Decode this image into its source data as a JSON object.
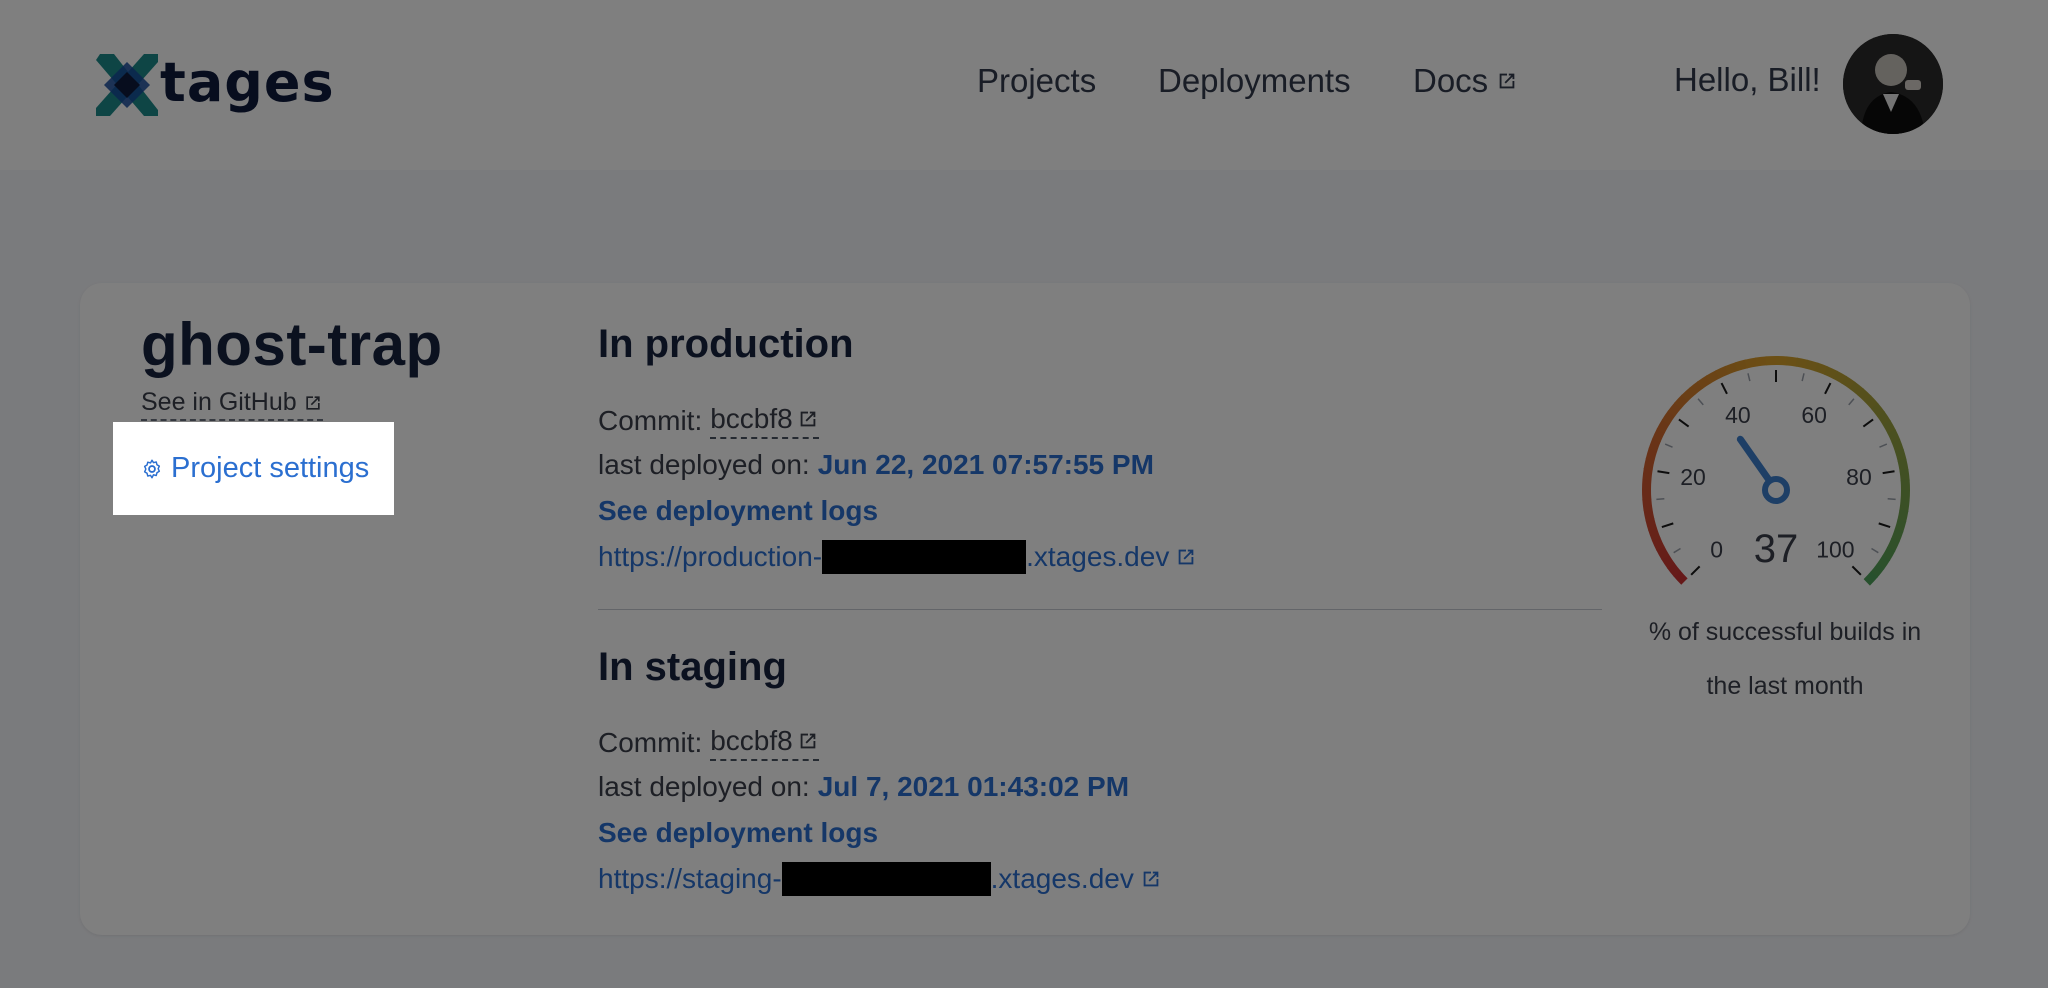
{
  "navbar": {
    "logo_text": "tages",
    "links": [
      "Projects",
      "Deployments",
      "Docs"
    ],
    "greeting": "Hello, Bill!"
  },
  "project": {
    "name": "ghost-trap",
    "github_label": "See in GitHub",
    "settings_label": "Project settings"
  },
  "production": {
    "title": "In production",
    "commit_label": "Commit:",
    "commit": "bccbf8",
    "deployed_label": "last deployed on:",
    "deployed_on": "Jun 22, 2021 07:57:55 PM",
    "logs_label": "See deployment logs",
    "url_prefix": "https://production-",
    "url_suffix": ".xtages.dev"
  },
  "staging": {
    "title": "In staging",
    "commit_label": "Commit:",
    "commit": "bccbf8",
    "deployed_label": "last deployed on:",
    "deployed_on": "Jul 7, 2021 01:43:02 PM",
    "logs_label": "See deployment logs",
    "url_prefix": "https://staging-",
    "url_suffix": ".xtages.dev"
  },
  "gauge": {
    "value": 37,
    "min": 0,
    "max": 100,
    "tick_labels": [
      "0",
      "20",
      "40",
      "60",
      "80",
      "100"
    ],
    "value_label": "37",
    "caption": "% of successful builds in the last month"
  },
  "colors": {
    "link_blue": "#2b6fd0",
    "brand_navy": "#0f1b3d",
    "brand_teal": "#1d8a8a",
    "overlay": "rgba(0,0,0,0.5)"
  }
}
